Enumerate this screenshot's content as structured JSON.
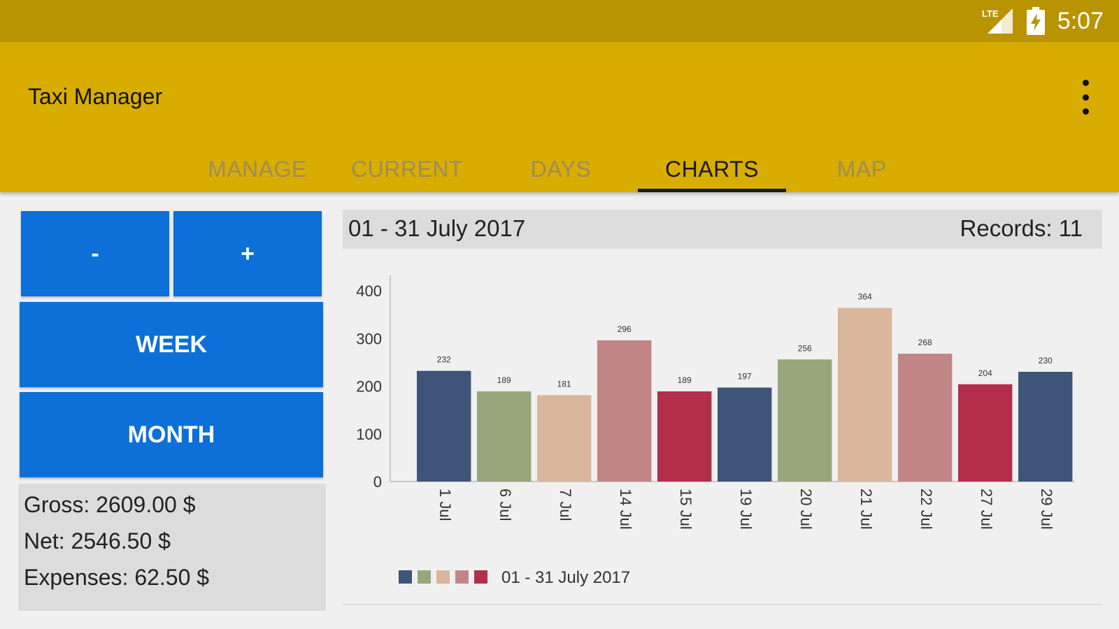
{
  "status_bar": {
    "network": "LTE",
    "time": "5:07"
  },
  "app_bar": {
    "title": "Taxi Manager",
    "menu_icon": "overflow-menu-icon"
  },
  "tabs": [
    {
      "label": "MANAGE",
      "active": false
    },
    {
      "label": "CURRENT",
      "active": false
    },
    {
      "label": "DAYS",
      "active": false
    },
    {
      "label": "CHARTS",
      "active": true
    },
    {
      "label": "MAP",
      "active": false
    }
  ],
  "controls": {
    "prev_label": "-",
    "next_label": "+",
    "week_label": "WEEK",
    "month_label": "MONTH"
  },
  "summary": {
    "gross": "Gross: 2609.00 $",
    "net": "Net: 2546.50 $",
    "expenses": "Expenses: 62.50 $"
  },
  "period": {
    "title": "01 - 31 July 2017",
    "records": "Records: 11"
  },
  "colors": {
    "status_bar": "#b89400",
    "app_bar": "#d8ad00",
    "button": "#0d6fd8"
  },
  "chart_data": {
    "type": "bar",
    "categories": [
      "1 Jul",
      "6 Jul",
      "7 Jul",
      "14 Jul",
      "15 Jul",
      "19 Jul",
      "20 Jul",
      "21 Jul",
      "22 Jul",
      "27 Jul",
      "29 Jul"
    ],
    "values": [
      232,
      189,
      181,
      296,
      189,
      197,
      256,
      364,
      268,
      204,
      230
    ],
    "value_labels": [
      "232",
      "189",
      "181",
      "296",
      "189",
      "197",
      "256",
      "364",
      "268",
      "204",
      "230"
    ],
    "y_ticks": [
      "0",
      "100",
      "200",
      "300",
      "400"
    ],
    "ylim": [
      0,
      400
    ],
    "grid": false,
    "colors": [
      "#3e5478",
      "#97a77b",
      "#d9b59c",
      "#c18585",
      "#b32e4b"
    ],
    "legend": {
      "label": "01 - 31 July 2017",
      "placement": "bottom-left"
    }
  }
}
